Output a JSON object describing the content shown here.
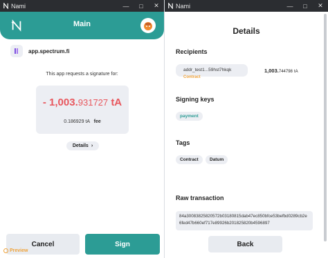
{
  "left_window": {
    "titlebar": {
      "app_name": "Nami",
      "controls": [
        "minimize-icon",
        "maximize-icon",
        "close-icon"
      ]
    },
    "header": {
      "title": "Main",
      "logo": "nami-logo-icon",
      "avatar": "avatar-icon"
    },
    "origin": {
      "url": "app.spectrum.fi",
      "favicon": "spectrum-favicon-icon"
    },
    "request_text": "This app requests a signature for:",
    "amount": {
      "sign": "-",
      "integer": "1,003.",
      "decimals": "931727",
      "unit": "tA"
    },
    "fee": {
      "value": "0.186929",
      "unit": "tA",
      "label": "fee"
    },
    "details_button": {
      "label": "Details",
      "icon": "chevron-right-icon"
    },
    "cancel_button": "Cancel",
    "sign_button": "Sign",
    "preview_label": "Preview"
  },
  "right_window": {
    "titlebar": {
      "app_name": "Nami",
      "controls": [
        "minimize-icon",
        "maximize-icon",
        "close-icon"
      ]
    },
    "title": "Details",
    "recipients": {
      "heading": "Recipients",
      "address": "addr_test1...59hst7hkqk",
      "tag": "Contract",
      "amount_integer": "1,003.",
      "amount_decimals": "744798",
      "amount_unit": "tA"
    },
    "signing_keys": {
      "heading": "Signing keys",
      "items": [
        "payment"
      ]
    },
    "tags": {
      "heading": "Tags",
      "items": [
        "Contract",
        "Datum"
      ]
    },
    "raw_transaction": {
      "heading": "Raw transaction",
      "value": "84a30083825820572b03180815dab47ec850bfce53befbd0289cb2e6fed47b660ef717e89926b201825820b4596897"
    },
    "back_button": "Back"
  },
  "colors": {
    "accent": "#2c9c95",
    "negative": "#e8575d",
    "warning": "#f0a33a",
    "titlebar": "#2b2d31"
  }
}
